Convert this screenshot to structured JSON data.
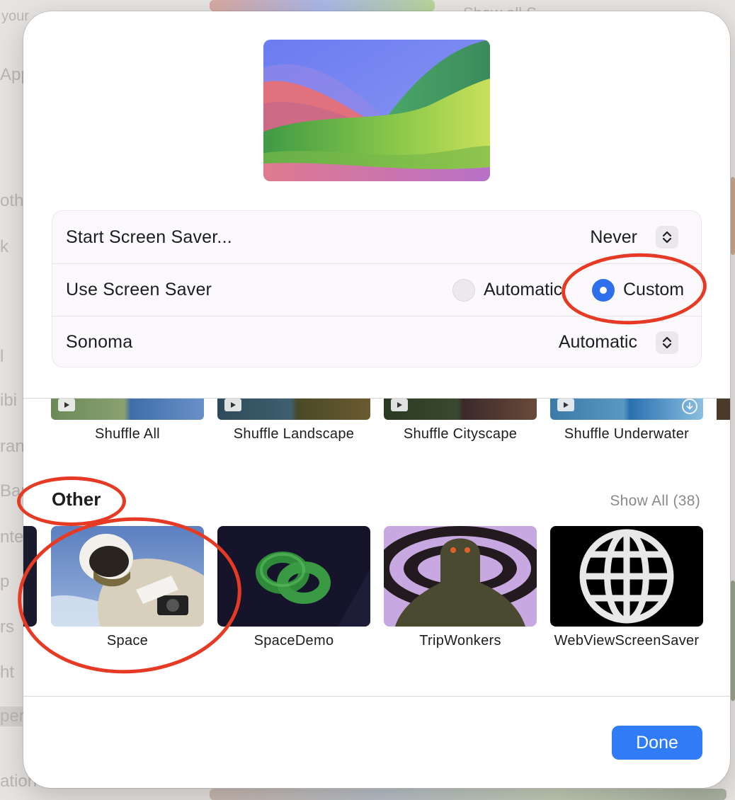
{
  "background": {
    "sidebar_fragments": [
      "your",
      "App",
      "oth",
      "k",
      "l",
      "ibi",
      "ran",
      "Bar",
      "nte",
      "p",
      "rs",
      "ht",
      "per",
      "ation"
    ],
    "header_fragment": "Show all S"
  },
  "preview": {
    "wallpaper_name": "Sonoma",
    "icon": "sonoma-wallpaper-preview"
  },
  "settings": {
    "start_screen_saver": {
      "label": "Start Screen Saver...",
      "value": "Never"
    },
    "use_screen_saver": {
      "label": "Use Screen Saver",
      "options": [
        {
          "label": "Automatic",
          "selected": false
        },
        {
          "label": "Custom",
          "selected": true
        }
      ]
    },
    "screen_saver": {
      "label": "Sonoma",
      "value": "Automatic"
    }
  },
  "shuffle": {
    "items": [
      {
        "label": "Shuffle All"
      },
      {
        "label": "Shuffle Landscape"
      },
      {
        "label": "Shuffle Cityscape"
      },
      {
        "label": "Shuffle Underwater"
      }
    ]
  },
  "other": {
    "title": "Other",
    "show_all": "Show All (38)",
    "items": [
      {
        "label": "Space",
        "icon": "astronaut-thumbnail"
      },
      {
        "label": "SpaceDemo",
        "icon": "green-rings-thumbnail"
      },
      {
        "label": "TripWonkers",
        "icon": "trippy-figure-thumbnail"
      },
      {
        "label": "WebViewScreenSaver",
        "icon": "globe-icon"
      }
    ]
  },
  "footer": {
    "done_label": "Done"
  },
  "colors": {
    "accent": "#2f7cf6",
    "annotation": "#e63a24"
  }
}
